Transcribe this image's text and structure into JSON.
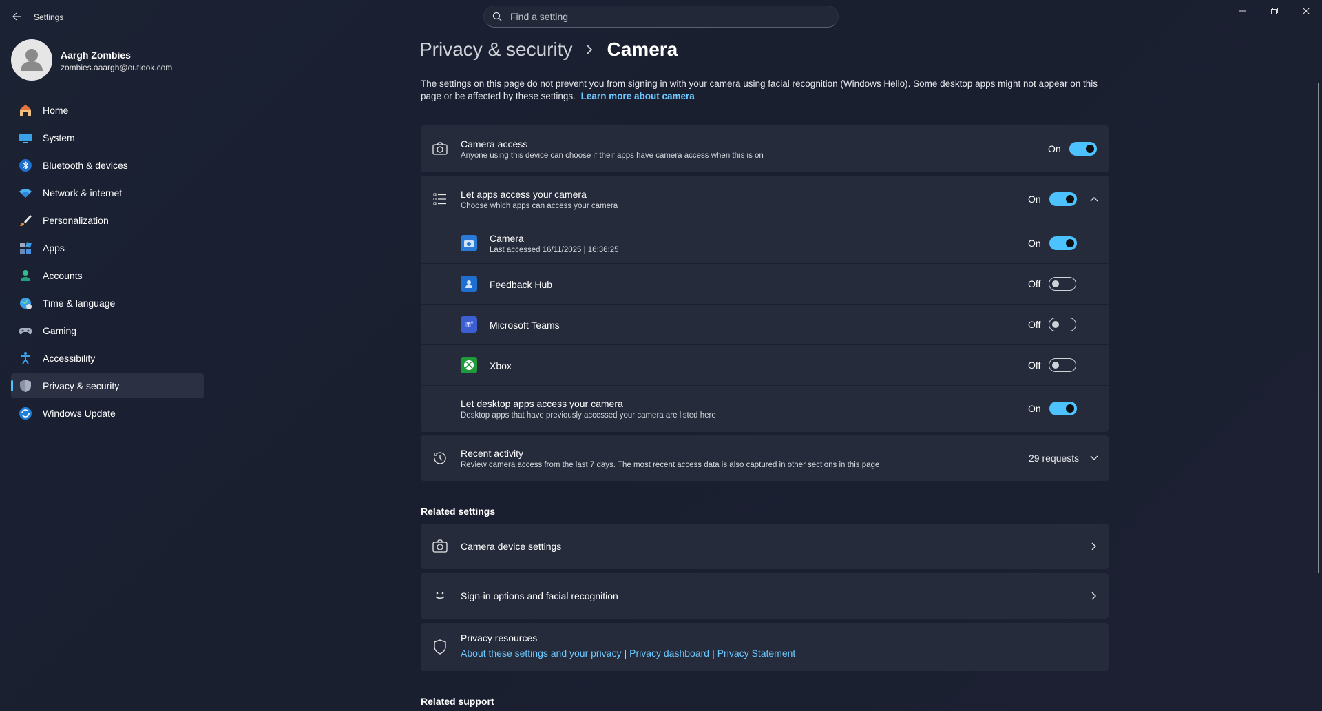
{
  "app": {
    "title": "Settings",
    "search_placeholder": "Find a setting"
  },
  "user": {
    "name": "Aargh Zombies",
    "email": "zombies.aaargh@outlook.com"
  },
  "nav": [
    {
      "label": "Home",
      "icon": "home-icon"
    },
    {
      "label": "System",
      "icon": "system-icon"
    },
    {
      "label": "Bluetooth & devices",
      "icon": "bluetooth-icon"
    },
    {
      "label": "Network & internet",
      "icon": "wifi-icon"
    },
    {
      "label": "Personalization",
      "icon": "brush-icon"
    },
    {
      "label": "Apps",
      "icon": "apps-icon"
    },
    {
      "label": "Accounts",
      "icon": "accounts-icon"
    },
    {
      "label": "Time & language",
      "icon": "globe-icon"
    },
    {
      "label": "Gaming",
      "icon": "gamepad-icon"
    },
    {
      "label": "Accessibility",
      "icon": "accessibility-icon"
    },
    {
      "label": "Privacy & security",
      "icon": "shield-icon",
      "active": true
    },
    {
      "label": "Windows Update",
      "icon": "update-icon"
    }
  ],
  "breadcrumb": {
    "parent": "Privacy & security",
    "current": "Camera"
  },
  "description": {
    "text": "The settings on this page do not prevent you from signing in with your camera using facial recognition (Windows Hello). Some desktop apps might not appear on this page or be affected by these settings.",
    "link": "Learn more about camera"
  },
  "camera_access": {
    "title": "Camera access",
    "subtitle": "Anyone using this device can choose if their apps have camera access when this is on",
    "state": "On"
  },
  "let_apps": {
    "title": "Let apps access your camera",
    "subtitle": "Choose which apps can access your camera",
    "state": "On"
  },
  "apps": [
    {
      "name": "Camera",
      "detail": "Last accessed 16/11/2025  |  16:36:25",
      "state": "On"
    },
    {
      "name": "Feedback Hub",
      "detail": "",
      "state": "Off"
    },
    {
      "name": "Microsoft Teams",
      "detail": "",
      "state": "Off"
    },
    {
      "name": "Xbox",
      "detail": "",
      "state": "Off"
    }
  ],
  "desktop_apps": {
    "title": "Let desktop apps access your camera",
    "subtitle": "Desktop apps that have previously accessed your camera are listed here",
    "state": "On"
  },
  "recent_activity": {
    "title": "Recent activity",
    "subtitle": "Review camera access from the last 7 days. The most recent access data is also captured in other sections in this page",
    "count": "29 requests"
  },
  "related_settings": {
    "heading": "Related settings",
    "camera_device": "Camera device settings",
    "sign_in": "Sign-in options and facial recognition",
    "privacy_resources": {
      "title": "Privacy resources",
      "link1": "About these settings and your privacy",
      "link2": "Privacy dashboard",
      "link3": "Privacy Statement",
      "separator": "|"
    }
  },
  "related_support": {
    "heading": "Related support"
  },
  "colors": {
    "accent": "#4cc2ff",
    "link": "#6cc8ff",
    "card": "#252b3a",
    "background": "#1b2233"
  }
}
